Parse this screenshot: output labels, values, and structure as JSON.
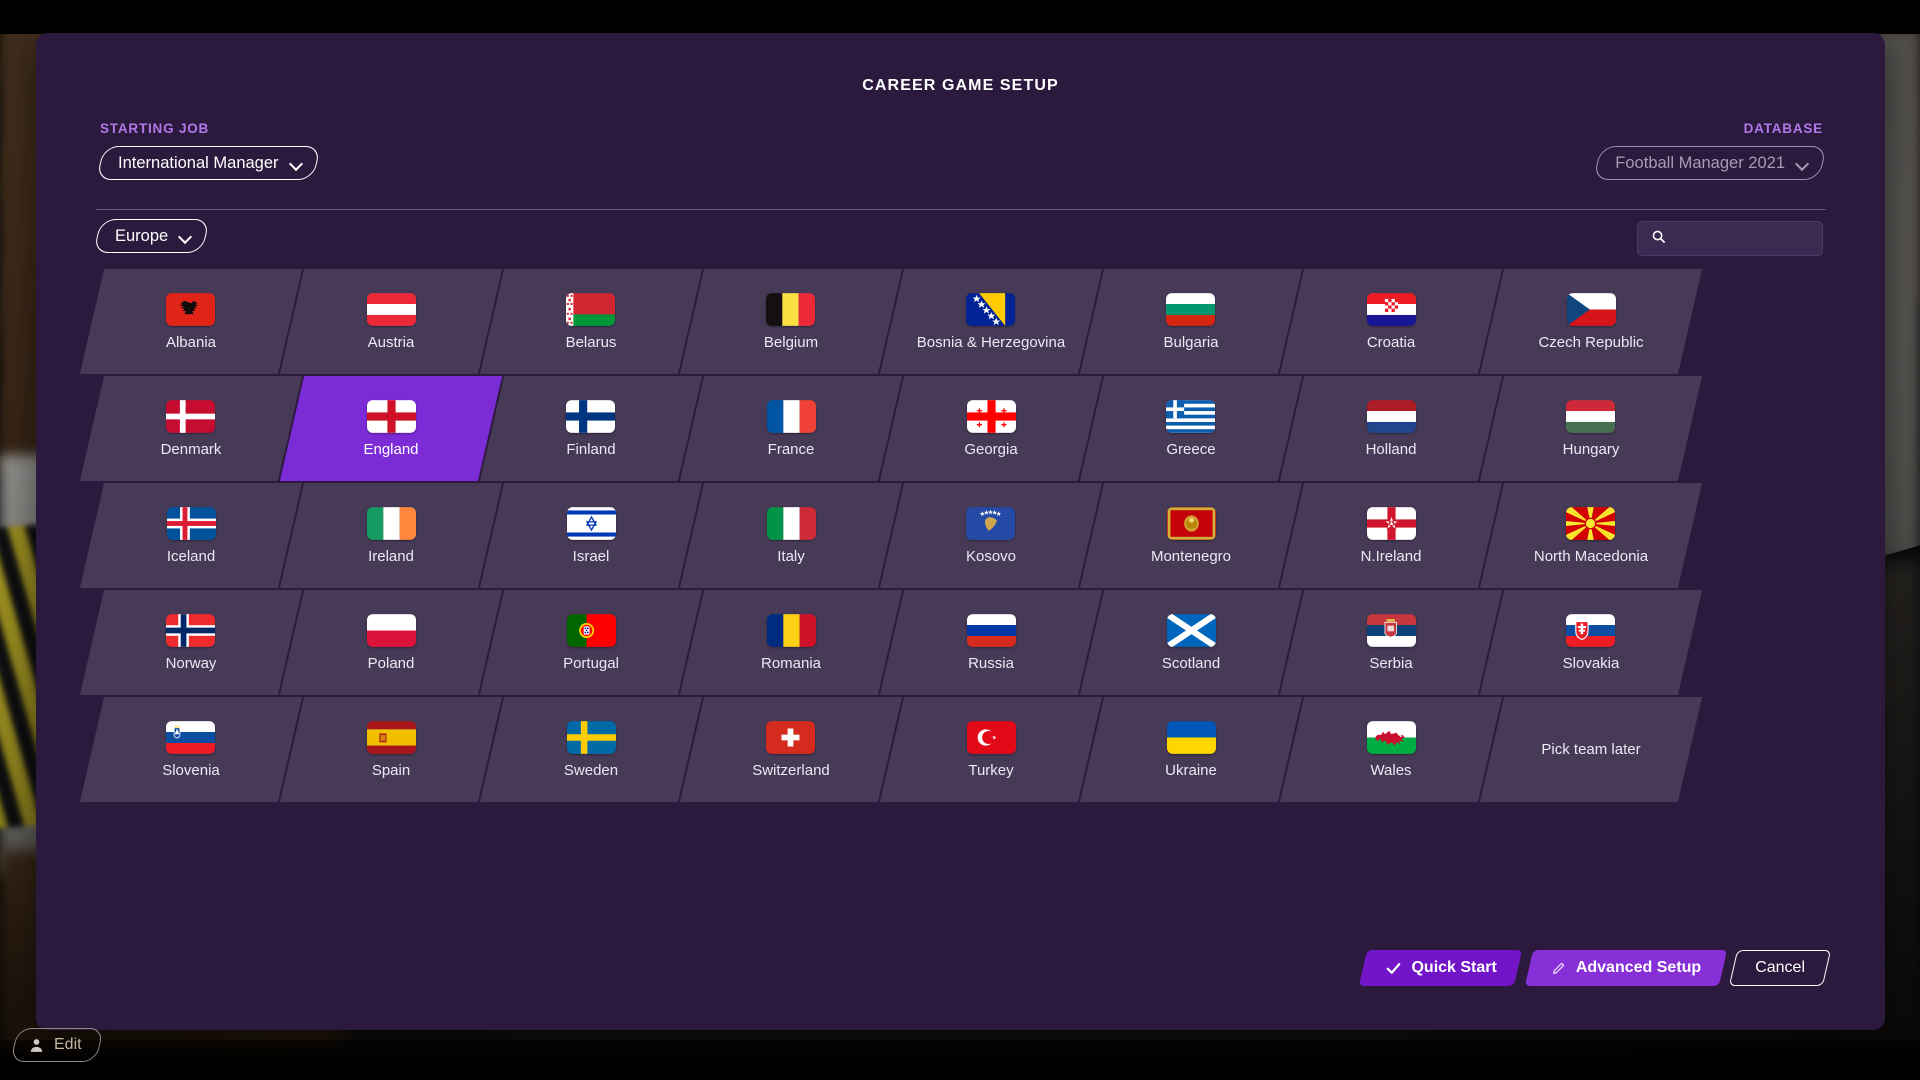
{
  "window": {
    "title": "CAREER GAME SETUP"
  },
  "header": {
    "starting_job": {
      "label": "STARTING JOB",
      "value": "International Manager",
      "icon": "chevron-down-icon"
    },
    "database": {
      "label": "DATABASE",
      "value": "Football Manager 2021",
      "icon": "chevron-down-icon"
    }
  },
  "filters": {
    "region": {
      "value": "Europe",
      "icon": "chevron-down-icon"
    },
    "search": {
      "value": "",
      "placeholder": "",
      "icon": "search-icon"
    }
  },
  "grid": {
    "rows": [
      [
        {
          "name": "Albania",
          "flag": "albania"
        },
        {
          "name": "Austria",
          "flag": "austria"
        },
        {
          "name": "Belarus",
          "flag": "belarus"
        },
        {
          "name": "Belgium",
          "flag": "belgium"
        },
        {
          "name": "Bosnia & Herzegovina",
          "flag": "bosnia"
        },
        {
          "name": "Bulgaria",
          "flag": "bulgaria"
        },
        {
          "name": "Croatia",
          "flag": "croatia"
        },
        {
          "name": "Czech Republic",
          "flag": "czech"
        }
      ],
      [
        {
          "name": "Denmark",
          "flag": "denmark"
        },
        {
          "name": "England",
          "flag": "england",
          "selected": true
        },
        {
          "name": "Finland",
          "flag": "finland"
        },
        {
          "name": "France",
          "flag": "france"
        },
        {
          "name": "Georgia",
          "flag": "georgia"
        },
        {
          "name": "Greece",
          "flag": "greece"
        },
        {
          "name": "Holland",
          "flag": "holland"
        },
        {
          "name": "Hungary",
          "flag": "hungary"
        }
      ],
      [
        {
          "name": "Iceland",
          "flag": "iceland"
        },
        {
          "name": "Ireland",
          "flag": "ireland"
        },
        {
          "name": "Israel",
          "flag": "israel"
        },
        {
          "name": "Italy",
          "flag": "italy"
        },
        {
          "name": "Kosovo",
          "flag": "kosovo"
        },
        {
          "name": "Montenegro",
          "flag": "montenegro"
        },
        {
          "name": "N.Ireland",
          "flag": "nireland"
        },
        {
          "name": "North Macedonia",
          "flag": "macedonia"
        }
      ],
      [
        {
          "name": "Norway",
          "flag": "norway"
        },
        {
          "name": "Poland",
          "flag": "poland"
        },
        {
          "name": "Portugal",
          "flag": "portugal"
        },
        {
          "name": "Romania",
          "flag": "romania"
        },
        {
          "name": "Russia",
          "flag": "russia"
        },
        {
          "name": "Scotland",
          "flag": "scotland"
        },
        {
          "name": "Serbia",
          "flag": "serbia"
        },
        {
          "name": "Slovakia",
          "flag": "slovakia"
        }
      ],
      [
        {
          "name": "Slovenia",
          "flag": "slovenia"
        },
        {
          "name": "Spain",
          "flag": "spain"
        },
        {
          "name": "Sweden",
          "flag": "sweden"
        },
        {
          "name": "Switzerland",
          "flag": "switzerland"
        },
        {
          "name": "Turkey",
          "flag": "turkey"
        },
        {
          "name": "Ukraine",
          "flag": "ukraine"
        },
        {
          "name": "Wales",
          "flag": "wales"
        },
        {
          "name": "Pick team later",
          "flag": null
        }
      ]
    ]
  },
  "footer": {
    "quick_start": {
      "label": "Quick Start",
      "icon": "check-icon"
    },
    "advanced_setup": {
      "label": "Advanced Setup",
      "icon": "pencil-icon"
    },
    "cancel": {
      "label": "Cancel"
    }
  },
  "overlay": {
    "edit": {
      "label": "Edit",
      "icon": "person-icon"
    }
  },
  "colors": {
    "modal_bg": "#2c1a3e",
    "tile_bg": "#473a57",
    "tile_selected": "#7c2cd6",
    "label_accent": "#b078e8",
    "primary_button": "#7215c9",
    "secondary_button": "#8730d8"
  }
}
